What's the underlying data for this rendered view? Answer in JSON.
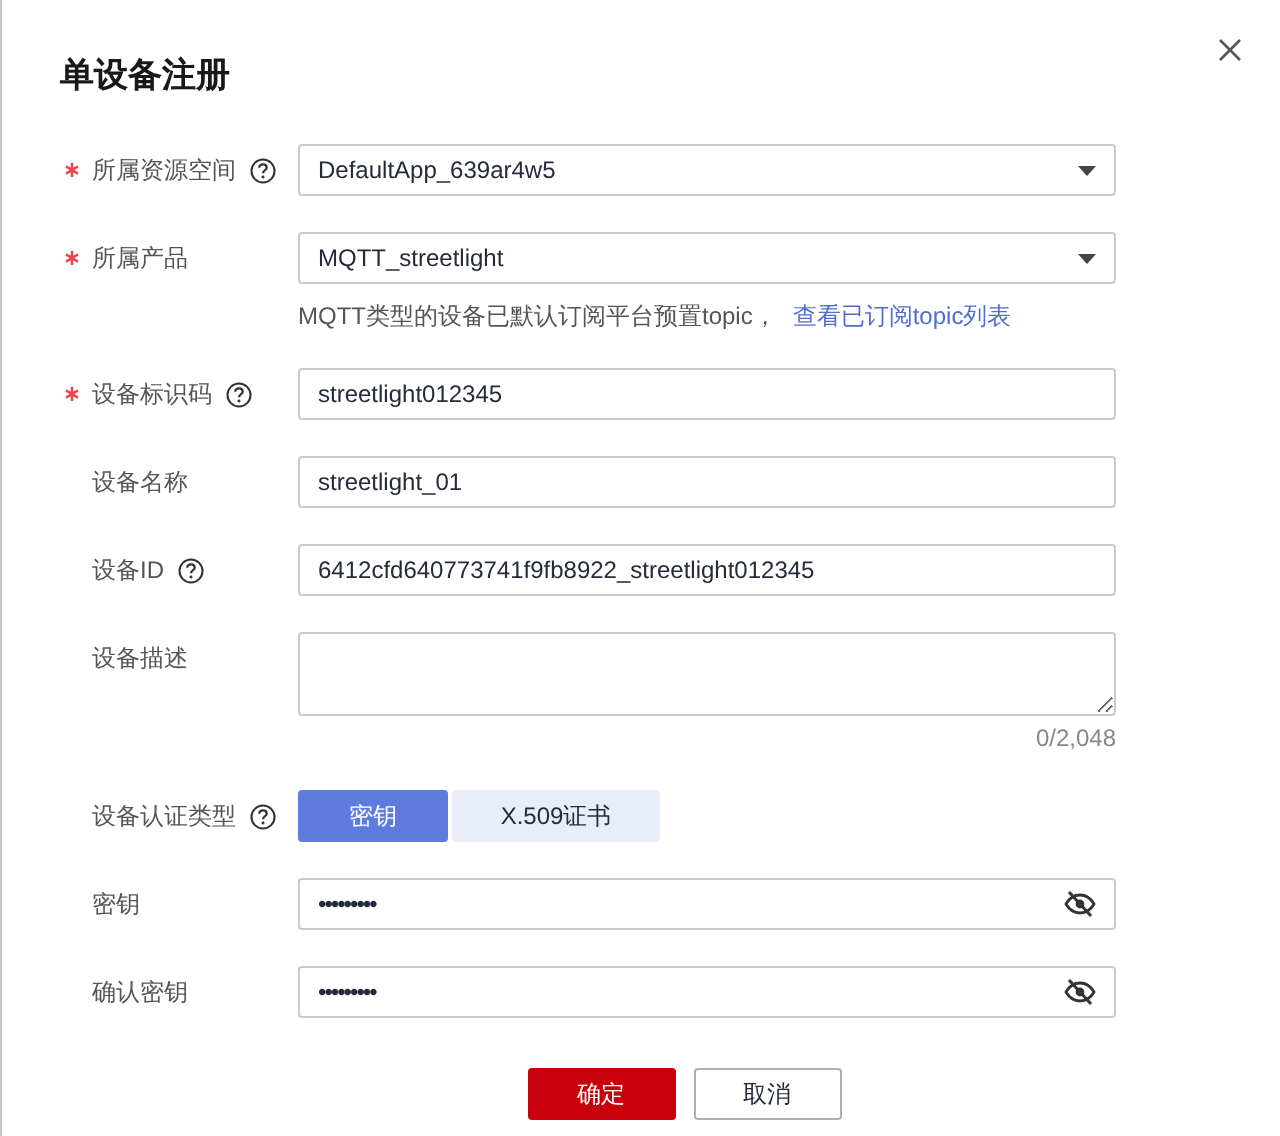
{
  "dialog": {
    "title": "单设备注册"
  },
  "fields": [
    {
      "kind": "select",
      "label": "所属资源空间",
      "required": true,
      "help": true,
      "value": "DefaultApp_639ar4w5"
    },
    {
      "kind": "select",
      "label": "所属产品",
      "required": true,
      "help": false,
      "value": "MQTT_streetlight",
      "hint": "MQTT类型的设备已默认订阅平台预置topic，",
      "hint_link": "查看已订阅topic列表"
    },
    {
      "kind": "input",
      "label": "设备标识码",
      "required": true,
      "help": true,
      "value": "streetlight012345"
    },
    {
      "kind": "input",
      "label": "设备名称",
      "required": false,
      "help": false,
      "value": "streetlight_01"
    },
    {
      "kind": "input",
      "label": "设备ID",
      "required": false,
      "help": true,
      "value": "6412cfd640773741f9fb8922_streetlight012345"
    },
    {
      "kind": "textarea",
      "label": "设备描述",
      "required": false,
      "help": false,
      "counter": "0/2,048"
    },
    {
      "kind": "segmented",
      "label": "设备认证类型",
      "required": false,
      "help": true,
      "options": [
        {
          "label": "密钥",
          "selected": true
        },
        {
          "label": "X.509证书",
          "selected": false
        }
      ]
    },
    {
      "kind": "password",
      "label": "密钥",
      "required": false,
      "help": false,
      "value": "•••••••••"
    },
    {
      "kind": "password",
      "label": "确认密钥",
      "required": false,
      "help": false,
      "value": "•••••••••"
    }
  ],
  "buttons": [
    {
      "label": "确定",
      "primary": true
    },
    {
      "label": "取消",
      "primary": false
    }
  ]
}
